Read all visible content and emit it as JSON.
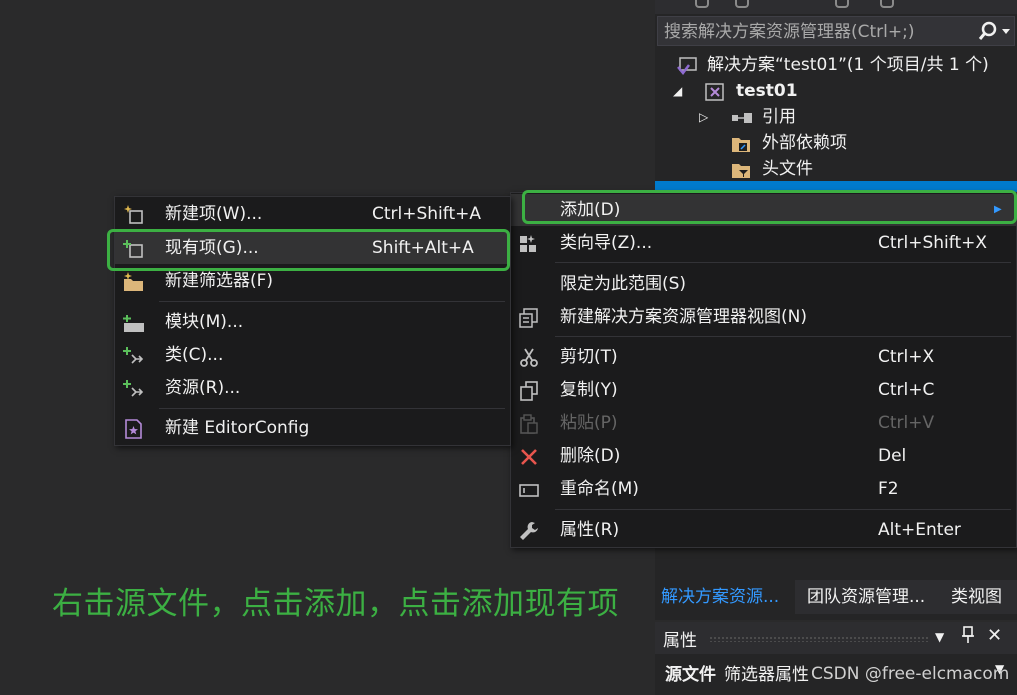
{
  "solution_explorer": {
    "search_placeholder": "搜索解决方案资源管理器(Ctrl+;)",
    "search_icon": "⚲",
    "tree": [
      {
        "label": "解决方案“test01”(1 个项目/共 1 个)",
        "icon": "solution-icon"
      },
      {
        "label": "test01",
        "icon": "project-icon",
        "expanded": true
      },
      {
        "label": "引用",
        "icon": "references-icon",
        "expanded": false
      },
      {
        "label": "外部依赖项",
        "icon": "external-deps-icon"
      },
      {
        "label": "头文件",
        "icon": "folder-filter-icon"
      }
    ],
    "tabs": [
      "解决方案资源...",
      "团队资源管理...",
      "类视图"
    ]
  },
  "properties": {
    "title": "属性",
    "object_name": "源文件",
    "object_kind": "筛选器属性"
  },
  "context_menu": {
    "items": [
      {
        "label": "添加(D)",
        "shortcut": "",
        "icon": "",
        "submenu": true
      },
      {
        "label": "类向导(Z)...",
        "shortcut": "Ctrl+Shift+X",
        "icon": "class-wizard-icon"
      },
      {
        "label": "限定为此范围(S)",
        "shortcut": "",
        "icon": ""
      },
      {
        "label": "新建解决方案资源管理器视图(N)",
        "shortcut": "",
        "icon": "new-view-icon"
      },
      {
        "label": "剪切(T)",
        "shortcut": "Ctrl+X",
        "icon": "scissors-icon"
      },
      {
        "label": "复制(Y)",
        "shortcut": "Ctrl+C",
        "icon": "copy-icon"
      },
      {
        "label": "粘贴(P)",
        "shortcut": "Ctrl+V",
        "icon": "paste-icon",
        "disabled": true
      },
      {
        "label": "删除(D)",
        "shortcut": "Del",
        "icon": "delete-icon"
      },
      {
        "label": "重命名(M)",
        "shortcut": "F2",
        "icon": "rename-icon"
      },
      {
        "label": "属性(R)",
        "shortcut": "Alt+Enter",
        "icon": "wrench-icon"
      }
    ]
  },
  "add_submenu": {
    "items": [
      {
        "label": "新建项(W)...",
        "shortcut": "Ctrl+Shift+A",
        "icon": "new-item-icon"
      },
      {
        "label": "现有项(G)...",
        "shortcut": "Shift+Alt+A",
        "icon": "existing-item-icon"
      },
      {
        "label": "新建筛选器(F)",
        "shortcut": "",
        "icon": "new-filter-icon"
      },
      {
        "label": "模块(M)...",
        "shortcut": "",
        "icon": "module-icon"
      },
      {
        "label": "类(C)...",
        "shortcut": "",
        "icon": "class-icon"
      },
      {
        "label": "资源(R)...",
        "shortcut": "",
        "icon": "resource-icon"
      },
      {
        "label": "新建 EditorConfig",
        "shortcut": "",
        "icon": "editorconfig-icon"
      }
    ]
  },
  "annotation": {
    "text": "右击源文件，点击添加，点击添加现有项",
    "color": "#3cb043"
  },
  "watermark": "CSDN @free-elcmacom",
  "colors": {
    "accent": "#007acc",
    "highlight_box": "#3cb043",
    "menu_bg": "#1b1b1c",
    "hover_bg": "#333334"
  }
}
